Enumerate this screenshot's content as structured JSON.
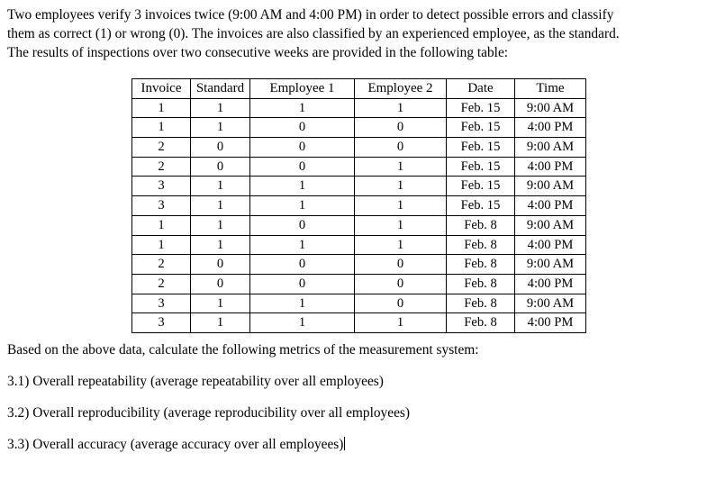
{
  "document": {
    "intro_lines": [
      "Two employees verify 3 invoices twice (9:00 AM and 4:00 PM) in order to detect possible errors and classify",
      "them as correct (1) or wrong (0). The invoices are also classified by an experienced employee, as the standard.",
      "The results of inspections over two consecutive weeks are provided in the following table:"
    ],
    "table": {
      "headers": [
        "Invoice",
        "Standard",
        "Employee 1",
        "Employee 2",
        "Date",
        "Time"
      ],
      "rows": [
        [
          "1",
          "1",
          "1",
          "1",
          "Feb. 15",
          "9:00 AM"
        ],
        [
          "1",
          "1",
          "0",
          "0",
          "Feb. 15",
          "4:00 PM"
        ],
        [
          "2",
          "0",
          "0",
          "0",
          "Feb. 15",
          "9:00 AM"
        ],
        [
          "2",
          "0",
          "0",
          "1",
          "Feb. 15",
          "4:00 PM"
        ],
        [
          "3",
          "1",
          "1",
          "1",
          "Feb. 15",
          "9:00 AM"
        ],
        [
          "3",
          "1",
          "1",
          "1",
          "Feb. 15",
          "4:00 PM"
        ],
        [
          "1",
          "1",
          "0",
          "1",
          "Feb. 8",
          "9:00 AM"
        ],
        [
          "1",
          "1",
          "1",
          "1",
          "Feb. 8",
          "4:00 PM"
        ],
        [
          "2",
          "0",
          "0",
          "0",
          "Feb. 8",
          "9:00 AM"
        ],
        [
          "2",
          "0",
          "0",
          "0",
          "Feb. 8",
          "4:00 PM"
        ],
        [
          "3",
          "1",
          "1",
          "0",
          "Feb. 8",
          "9:00 AM"
        ],
        [
          "3",
          "1",
          "1",
          "1",
          "Feb. 8",
          "4:00 PM"
        ]
      ]
    },
    "prompt": "Based on the above data, calculate the following metrics of the measurement system:",
    "questions": [
      "3.1) Overall repeatability (average repeatability over all employees)",
      "3.2) Overall reproducibility (average reproducibility over all employees)",
      "3.3) Overall accuracy (average accuracy over all employees)"
    ]
  }
}
